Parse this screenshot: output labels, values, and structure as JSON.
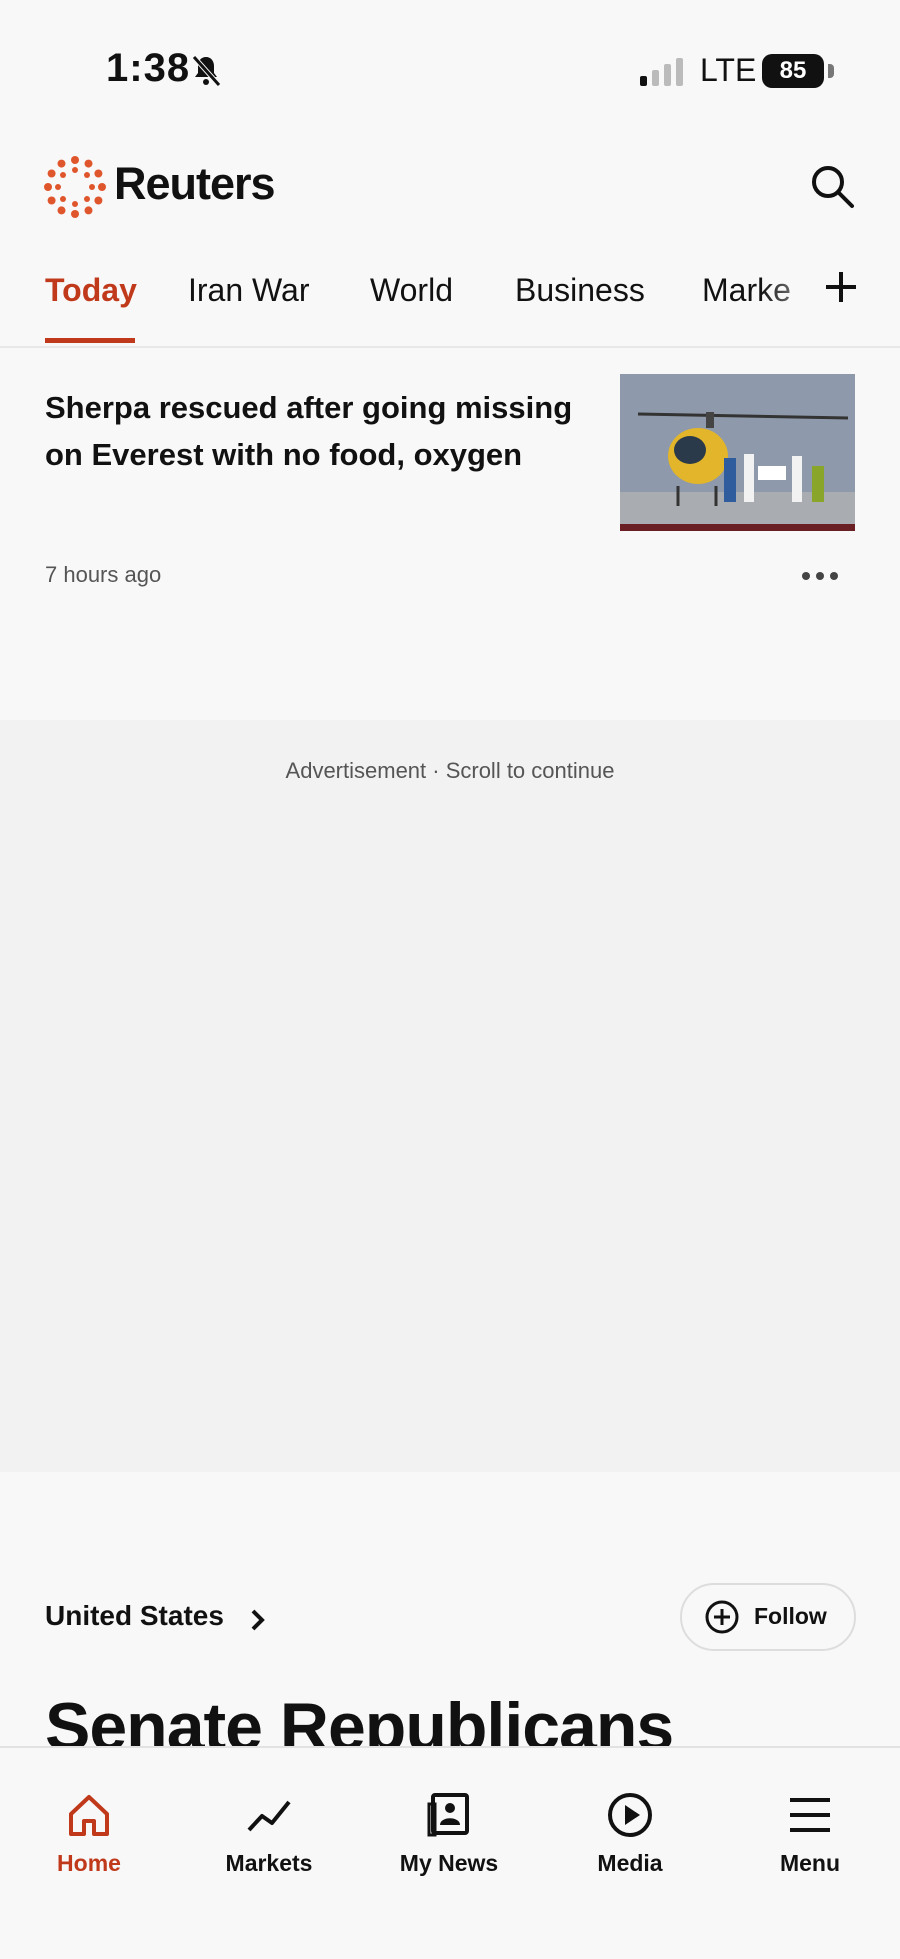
{
  "status_bar": {
    "time": "1:38",
    "network": "LTE",
    "battery": "85"
  },
  "header": {
    "brand": "Reuters"
  },
  "tabs": [
    {
      "label": "Today",
      "active": true
    },
    {
      "label": "Iran War"
    },
    {
      "label": "World"
    },
    {
      "label": "Business"
    },
    {
      "label": "Marke"
    }
  ],
  "story": {
    "headline": "Sherpa rescued after going missing on Everest with no food, oxygen",
    "time_ago": "7 hours ago"
  },
  "ad": {
    "label": "Advertisement · Scroll to continue"
  },
  "section": {
    "title": "United States",
    "follow_label": "Follow",
    "next_headline": "Senate Republicans"
  },
  "bottom_nav": [
    {
      "label": "Home",
      "icon": "home-icon",
      "active": true
    },
    {
      "label": "Markets",
      "icon": "markets-icon"
    },
    {
      "label": "My News",
      "icon": "my-news-icon"
    },
    {
      "label": "Media",
      "icon": "play-icon"
    },
    {
      "label": "Menu",
      "icon": "menu-icon"
    }
  ],
  "colors": {
    "accent": "#c0391b",
    "background": "#f8f8f8",
    "ad_background": "#f2f2f2"
  }
}
